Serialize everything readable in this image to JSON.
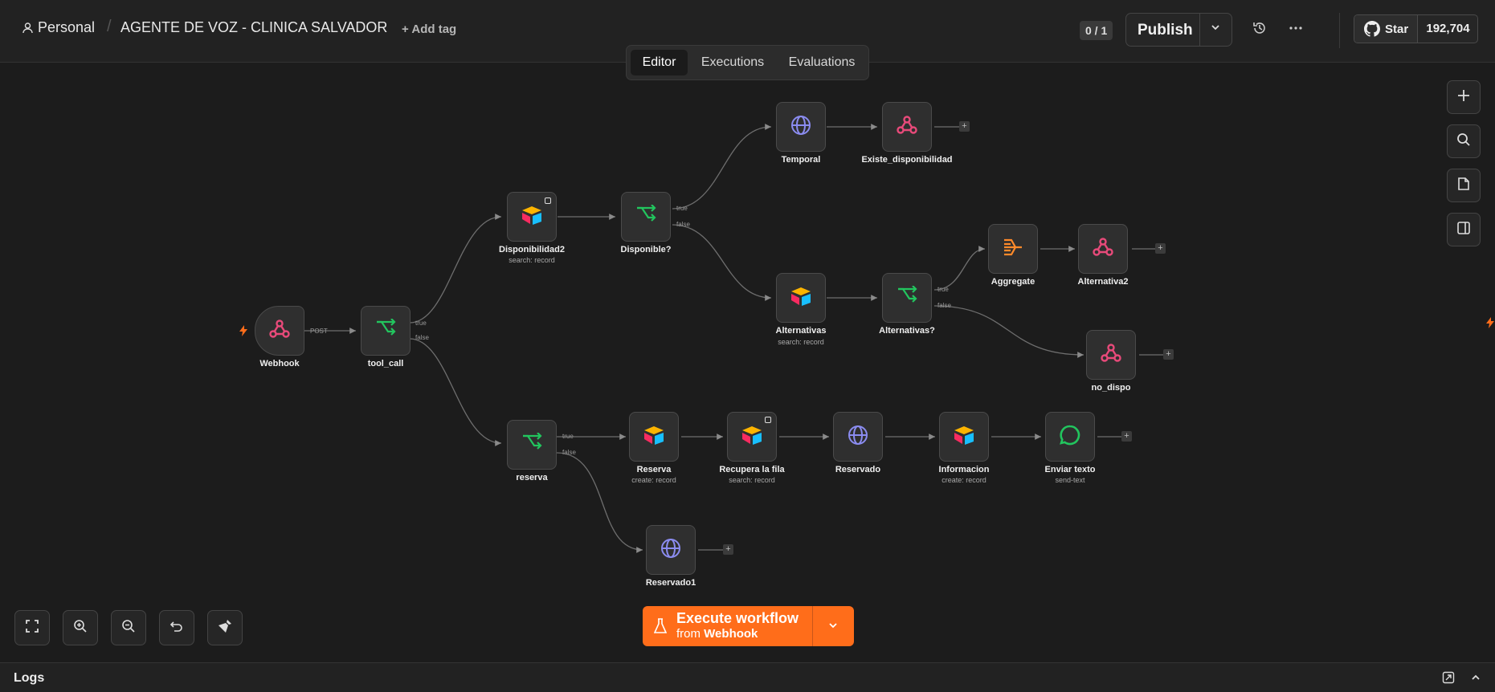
{
  "breadcrumb": {
    "project": "Personal",
    "separator": "/",
    "workflow_title": "AGENTE DE VOZ - CLINICA SALVADOR"
  },
  "header": {
    "add_tag": "+ Add tag",
    "version_counter": "0 / 1",
    "publish_label": "Publish",
    "github_star_label": "Star",
    "github_star_count": "192,704"
  },
  "tabs": [
    "Editor",
    "Executions",
    "Evaluations"
  ],
  "nodes": {
    "webhook": {
      "label": "Webhook",
      "port": "POST"
    },
    "tool_call": {
      "label": "tool_call"
    },
    "disponibilidad2": {
      "label": "Disponibilidad2",
      "sub": "search: record"
    },
    "disponible": {
      "label": "Disponible?"
    },
    "temporal": {
      "label": "Temporal"
    },
    "existe": {
      "label": "Existe_disponibilidad"
    },
    "alternativas": {
      "label": "Alternativas",
      "sub": "search: record"
    },
    "alternativas_q": {
      "label": "Alternativas?"
    },
    "aggregate": {
      "label": "Aggregate"
    },
    "alternativa2": {
      "label": "Alternativa2"
    },
    "no_dispo": {
      "label": "no_dispo"
    },
    "reserva_if": {
      "label": "reserva"
    },
    "reserva": {
      "label": "Reserva",
      "sub": "create: record"
    },
    "recupera": {
      "label": "Recupera la fila",
      "sub": "search: record"
    },
    "reservado": {
      "label": "Reservado"
    },
    "informacion": {
      "label": "Informacion",
      "sub": "create: record"
    },
    "enviar": {
      "label": "Enviar texto",
      "sub": "send-text"
    },
    "reservado1": {
      "label": "Reservado1"
    }
  },
  "ports": {
    "true": "true",
    "false": "false"
  },
  "execute": {
    "main": "Execute workflow",
    "from": "from",
    "trigger": "Webhook"
  },
  "logs": {
    "label": "Logs"
  },
  "colors": {
    "accent": "#ff6d1a",
    "webhook": "#e84a7a",
    "if": "#22c55e",
    "http": "#8b8cf0",
    "aggregate": "#ff8a2a"
  }
}
